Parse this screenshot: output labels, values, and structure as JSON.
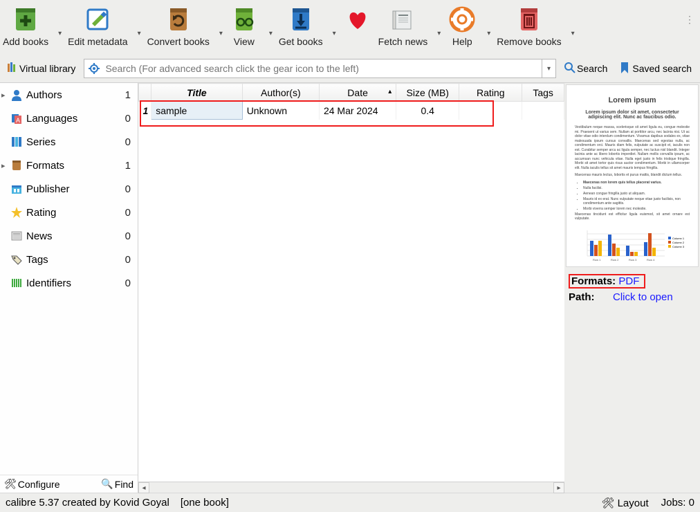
{
  "toolbar": [
    {
      "id": "add-books",
      "label": "Add books",
      "dropdown": true
    },
    {
      "id": "edit-metadata",
      "label": "Edit metadata",
      "dropdown": true
    },
    {
      "id": "convert-books",
      "label": "Convert books",
      "dropdown": true
    },
    {
      "id": "view",
      "label": "View",
      "dropdown": true
    },
    {
      "id": "get-books",
      "label": "Get books",
      "dropdown": true
    },
    {
      "id": "donate",
      "label": "",
      "dropdown": false
    },
    {
      "id": "fetch-news",
      "label": "Fetch news",
      "dropdown": true
    },
    {
      "id": "help",
      "label": "Help",
      "dropdown": true
    },
    {
      "id": "remove-books",
      "label": "Remove books",
      "dropdown": true
    }
  ],
  "secondary": {
    "virtual_library": "Virtual library",
    "search_placeholder": "Search (For advanced search click the gear icon to the left)",
    "search_btn": "Search",
    "saved_search": "Saved search"
  },
  "tag_browser": [
    {
      "label": "Authors",
      "count": 1,
      "icon": "authors",
      "expandable": true
    },
    {
      "label": "Languages",
      "count": 0,
      "icon": "languages",
      "expandable": false
    },
    {
      "label": "Series",
      "count": 0,
      "icon": "series",
      "expandable": false
    },
    {
      "label": "Formats",
      "count": 1,
      "icon": "formats",
      "expandable": true
    },
    {
      "label": "Publisher",
      "count": 0,
      "icon": "publisher",
      "expandable": false
    },
    {
      "label": "Rating",
      "count": 0,
      "icon": "rating",
      "expandable": false
    },
    {
      "label": "News",
      "count": 0,
      "icon": "news",
      "expandable": false
    },
    {
      "label": "Tags",
      "count": 0,
      "icon": "tags",
      "expandable": false
    },
    {
      "label": "Identifiers",
      "count": 0,
      "icon": "identifiers",
      "expandable": false
    }
  ],
  "sidebar_bottom": {
    "configure": "Configure",
    "find": "Find"
  },
  "columns": [
    "Title",
    "Author(s)",
    "Date",
    "Size (MB)",
    "Rating",
    "Tags"
  ],
  "rows": [
    {
      "idx": "1",
      "title": "sample",
      "author": "Unknown",
      "date": "24 Mar 2024",
      "size": "0.4",
      "rating": "",
      "tags": ""
    }
  ],
  "detail": {
    "cover_title": "Lorem ipsum",
    "cover_sub": "Lorem ipsum dolor sit amet, consectetur adipiscing elit. Nunc ac faucibus odio.",
    "formats_label": "Formats:",
    "formats_value": "PDF",
    "path_label": "Path:",
    "path_value": "Click to open"
  },
  "statusbar": {
    "credit": "calibre 5.37 created by Kovid Goyal",
    "count": "[one book]",
    "layout": "Layout",
    "jobs": "Jobs: 0"
  },
  "chart_data": {
    "type": "bar",
    "note": "Miniature grouped bar chart inside cover preview image (values approximate from pixels)",
    "categories": [
      "Row 1",
      "Row 2",
      "Row 3",
      "Row 4"
    ],
    "series": [
      {
        "name": "Column 1",
        "color": "#2962cc",
        "values": [
          3.0,
          4.2,
          2.0,
          2.8
        ]
      },
      {
        "name": "Column 2",
        "color": "#d3521e",
        "values": [
          2.2,
          2.4,
          0.8,
          4.4
        ]
      },
      {
        "name": "Column 3",
        "color": "#f4b400",
        "values": [
          3.0,
          1.6,
          0.8,
          1.6
        ]
      }
    ],
    "ylim": [
      0,
      5
    ]
  }
}
